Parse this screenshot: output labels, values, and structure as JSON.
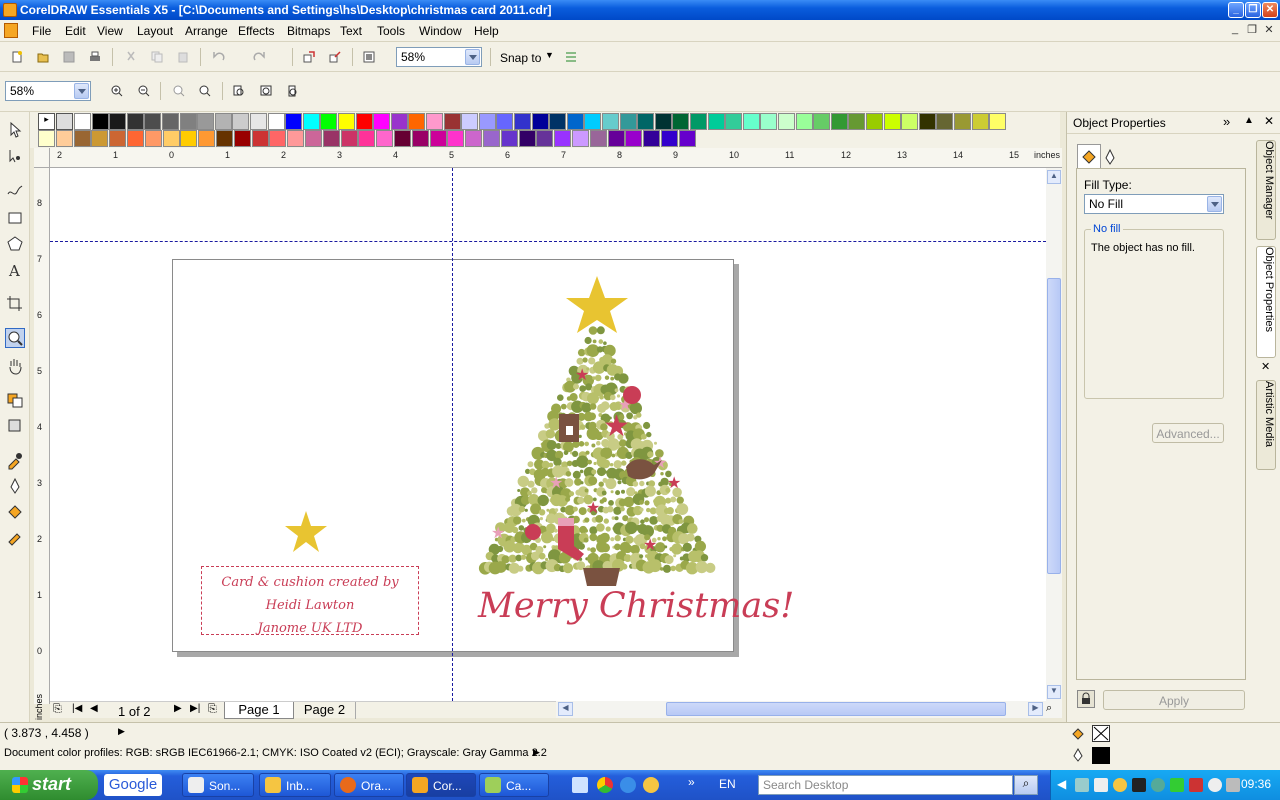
{
  "window": {
    "title": "CorelDRAW Essentials X5 - [C:\\Documents and Settings\\hs\\Desktop\\christmas card 2011.cdr]"
  },
  "menu": [
    {
      "label": "File",
      "key": "F"
    },
    {
      "label": "Edit",
      "key": "E"
    },
    {
      "label": "View",
      "key": "V"
    },
    {
      "label": "Layout",
      "key": "L"
    },
    {
      "label": "Arrange",
      "key": "A"
    },
    {
      "label": "Effects",
      "key": "c"
    },
    {
      "label": "Bitmaps",
      "key": "B"
    },
    {
      "label": "Text",
      "key": "x"
    },
    {
      "label": "Tools",
      "key": "o"
    },
    {
      "label": "Window",
      "key": "W"
    },
    {
      "label": "Help",
      "key": "H"
    }
  ],
  "toolbar": {
    "zoom_value": "58%",
    "snap_to": "Snap to"
  },
  "propertybar": {
    "zoom_value": "58%"
  },
  "rulers": {
    "unit": "inches",
    "h_ticks": [
      "2",
      "1",
      "0",
      "1",
      "2",
      "3",
      "4",
      "5",
      "6",
      "7",
      "8",
      "9",
      "10",
      "11",
      "12",
      "13",
      "14",
      "15"
    ],
    "v_ticks": [
      "8",
      "7",
      "6",
      "5",
      "4",
      "3",
      "2",
      "1",
      "0"
    ]
  },
  "card": {
    "credit_line1": "Card & cushion created by Heidi Lawton",
    "credit_line2": "Janome UK LTD",
    "greeting": "Merry Christmas!",
    "colors": {
      "star": "#e8c431",
      "tree": "#9aa84a",
      "accent": "#c93d56",
      "trunk": "#7a5240"
    }
  },
  "page_nav": {
    "counter": "1 of 2",
    "pages": [
      "Page 1",
      "Page 2"
    ]
  },
  "docker": {
    "title": "Object Properties",
    "fill_type_label": "Fill Type:",
    "fill_type_value": "No Fill",
    "group_label": "No fill",
    "message": "The object has no fill.",
    "advanced_button": "Advanced...",
    "apply_button": "Apply",
    "side_tabs": [
      "Object Manager",
      "Object Properties",
      "Artistic Media"
    ]
  },
  "status": {
    "coords": "( 3.873 , 4.458 )",
    "profiles": "Document color profiles: RGB: sRGB IEC61966-2.1; CMYK: ISO Coated v2 (ECI); Grayscale: Gray Gamma 2.2"
  },
  "palette_row1": [
    "#ffffff",
    "#000000",
    "#1a1a1a",
    "#333333",
    "#4d4d4d",
    "#666666",
    "#808080",
    "#999999",
    "#b3b3b3",
    "#cccccc",
    "#e6e6e6",
    "#ffffff",
    "#0000ff",
    "#00ffff",
    "#00ff00",
    "#ffff00",
    "#ff0000",
    "#ff00ff",
    "#9933cc",
    "#ff6600",
    "#ff99cc",
    "#993333",
    "#ccccff",
    "#9999ff",
    "#6666ff",
    "#3333cc",
    "#000099",
    "#003366",
    "#0066cc",
    "#00ccff",
    "#66cccc",
    "#339999",
    "#006666",
    "#003333",
    "#006633",
    "#009966",
    "#00cc99",
    "#33cc99",
    "#66ffcc",
    "#99ffcc",
    "#ccffcc",
    "#99ff99",
    "#66cc66",
    "#339933",
    "#669933",
    "#99cc00",
    "#ccff00",
    "#ccff66",
    "#333300",
    "#666633",
    "#999933",
    "#cccc33",
    "#ffff66"
  ],
  "palette_row2": [
    "#ffffcc",
    "#ffcc99",
    "#996633",
    "#cc9933",
    "#cc6633",
    "#ff6633",
    "#ff9966",
    "#ffcc66",
    "#ffcc00",
    "#ff9933",
    "#663300",
    "#990000",
    "#cc3333",
    "#ff6666",
    "#ff9999",
    "#cc6699",
    "#993366",
    "#cc3366",
    "#ff3399",
    "#ff66cc",
    "#660033",
    "#990066",
    "#cc0099",
    "#ff33cc",
    "#cc66cc",
    "#9966cc",
    "#6633cc",
    "#330066",
    "#663399",
    "#9933ff",
    "#cc99ff",
    "#996699",
    "#660099",
    "#9900cc",
    "#330099",
    "#3300cc",
    "#6600cc"
  ],
  "taskbar": {
    "start": "start",
    "search_placeholder": "Search Desktop",
    "lang": "EN",
    "clock": "09:36",
    "google": "Google",
    "tasks": [
      "Son...",
      "Inb...",
      "Ora...",
      "Cor...",
      "Ca..."
    ]
  }
}
